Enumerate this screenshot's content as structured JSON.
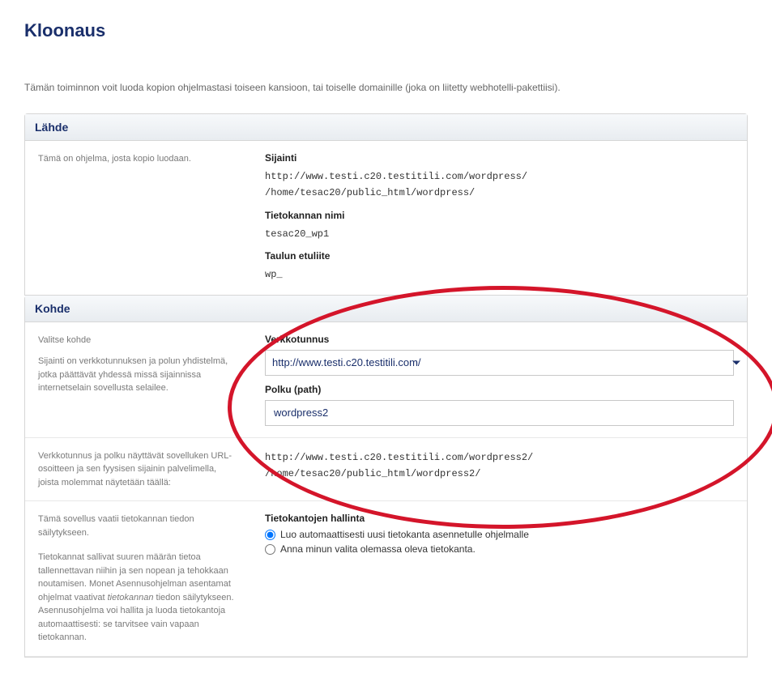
{
  "page": {
    "title": "Kloonaus",
    "intro": "Tämän toiminnon voit luoda kopion ohjelmastasi toiseen kansioon, tai toiselle domainille (joka on liitetty webhotelli-pakettiisi)."
  },
  "source": {
    "header": "Lähde",
    "desc": "Tämä on ohjelma, josta kopio luodaan.",
    "location_label": "Sijainti",
    "url": "http://www.testi.c20.testitili.com/wordpress/",
    "path": "/home/tesac20/public_html/wordpress/",
    "dbname_label": "Tietokannan nimi",
    "dbname": "tesac20_wp1",
    "prefix_label": "Taulun etuliite",
    "prefix": "wp_"
  },
  "target": {
    "header": "Kohde",
    "choose_label": "Valitse kohde",
    "choose_desc": "Sijainti on verkkotunnuksen ja polun yhdistelmä, jotka päättävät yhdessä missä sijainnissa internetselain sovellusta selailee.",
    "domain_label": "Verkkotunnus",
    "domain_value": "http://www.testi.c20.testitili.com/",
    "path_label": "Polku (path)",
    "path_value": "wordpress2",
    "preview_desc": "Verkkotunnus ja polku näyttävät sovelluken URL-osoitteen ja sen fyysisen sijainin palvelimella, joista molemmat näytetään täällä:",
    "preview_url": "http://www.testi.c20.testitili.com/wordpress2/",
    "preview_path": "/home/tesac20/public_html/wordpress2/",
    "db_desc1": "Tämä sovellus vaatii tietokannan tiedon säilytykseen.",
    "db_desc2_a": "Tietokannat sallivat suuren määrän tietoa tallennettavan niihin ja sen nopean ja tehokkaan noutamisen. Monet Asennusohjelman asentamat ohjelmat vaativat ",
    "db_desc2_em": "tietokannan",
    "db_desc2_b": " tiedon säilytykseen. Asennusohjelma voi hallita ja luoda tietokantoja automaattisesti: se tarvitsee vain vapaan tietokannan.",
    "db_mgmt_label": "Tietokantojen hallinta",
    "db_opt_auto": "Luo automaattisesti uusi tietokanta asennetulle ohjelmalle",
    "db_opt_manual": "Anna minun valita olemassa oleva tietokanta."
  }
}
